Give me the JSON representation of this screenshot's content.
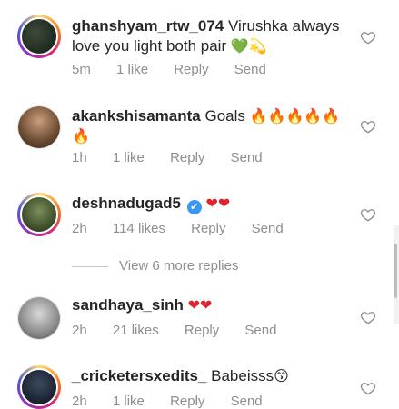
{
  "comments": [
    {
      "username": "ghanshyam_rtw_074",
      "text": "Virushka always love you light both pair",
      "emoji": "💚💫",
      "time": "5m",
      "likes": "1 like",
      "reply": "Reply",
      "send": "Send"
    },
    {
      "username": "akankshisamanta",
      "text": "Goals",
      "emoji": "🔥🔥🔥🔥🔥🔥",
      "time": "1h",
      "likes": "1 like",
      "reply": "Reply",
      "send": "Send"
    },
    {
      "username": "deshnadugad5",
      "text": "",
      "emoji": "❤❤",
      "time": "2h",
      "likes": "114 likes",
      "reply": "Reply",
      "send": "Send",
      "verified_mark": "✔"
    },
    {
      "username": "sandhaya_sinh",
      "text": "",
      "emoji": "❤❤",
      "time": "2h",
      "likes": "21 likes",
      "reply": "Reply",
      "send": "Send"
    },
    {
      "username": "_cricketersxedits_",
      "text": "Babeisss",
      "emoji": "😙",
      "time": "2h",
      "likes": "1 like",
      "reply": "Reply",
      "send": "Send"
    }
  ],
  "view_more": "View 6 more replies",
  "icons": {
    "like": "heart-outline-icon",
    "verified": "verified-badge-icon"
  },
  "colors": {
    "meta_text": "#8e8e8e",
    "verified": "#3897f0",
    "heart": "#e0242f"
  }
}
